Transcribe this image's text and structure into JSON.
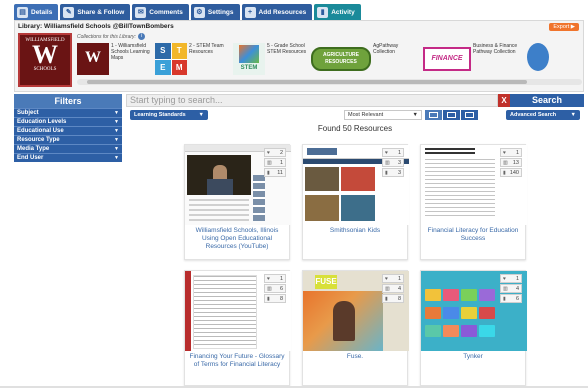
{
  "tabs": [
    {
      "label": "Details",
      "icon": "details-icon",
      "glyph": "▤"
    },
    {
      "label": "Share & Follow",
      "icon": "share-icon",
      "glyph": "✎"
    },
    {
      "label": "Comments",
      "icon": "comments-icon",
      "glyph": "✉"
    },
    {
      "label": "Settings",
      "icon": "gear-icon",
      "glyph": "⚙"
    },
    {
      "label": "Add Resources",
      "icon": "add-resources-icon",
      "glyph": "+"
    },
    {
      "label": "Activity",
      "icon": "activity-icon",
      "glyph": "▮"
    }
  ],
  "library": {
    "title": "Library: Williamsfield Schools @BillTownBombers",
    "export_label": "Export ▶",
    "logo_text_top": "WILLIAMSFIELD",
    "logo_letter": "W",
    "logo_text_bottom": "SCHOOLS",
    "collections_label": "Collections for this Library:",
    "info_glyph": "i",
    "collections": [
      {
        "label": "1 - Williamsfield Schools Learning Maps",
        "thumb_text": "W"
      },
      {
        "label": "2 - STEM Team Resources",
        "thumb_letters": [
          "S",
          "T",
          "E",
          "M"
        ]
      },
      {
        "label": "5 - Grade School STEM Resources",
        "thumb_text": "STEM"
      },
      {
        "label": "AgPathway Collection",
        "thumb_text": "AGRICULTURE RESOURCES"
      },
      {
        "label": "Business & Finance Pathway Collection",
        "thumb_text": "FINANCE"
      }
    ]
  },
  "filters": {
    "heading": "Filters",
    "items": [
      "Subject",
      "Education Levels",
      "Educational Use",
      "Resource Type",
      "Media Type",
      "End User"
    ],
    "arrow": "▼"
  },
  "search": {
    "placeholder": "Start typing to search...",
    "clear_label": "X",
    "button_label": "Search"
  },
  "toolbar": {
    "standards_label": "Learning Standards",
    "sort_value": "Most Relevant",
    "advanced_label": "Advanced Search",
    "dropdown_arrow": "▼"
  },
  "results": {
    "found_text": "Found 50 Resources",
    "cards": [
      {
        "title": "Williamsfield Schools, Illinois Using Open Educational Resources (YouTube)",
        "stats": [
          "2",
          "1",
          "11"
        ]
      },
      {
        "title": "Smithsonian Kids",
        "stats": [
          "1",
          "3",
          "3"
        ]
      },
      {
        "title": "Financial Literacy for Education Success",
        "stats": [
          "1",
          "13",
          "140"
        ]
      },
      {
        "title": "Financing Your Future - Glossary of Terms for Financial Literacy",
        "stats": [
          "1",
          "6",
          "8"
        ]
      },
      {
        "title": "Fuse.",
        "stats": [
          "1",
          "4",
          "8"
        ]
      },
      {
        "title": "Tynker",
        "stats": [
          "1",
          "4",
          "6"
        ]
      }
    ],
    "stat_icons": [
      "♥",
      "▥",
      "▮"
    ]
  },
  "shots": {
    "fuse_logo": "FUSE"
  },
  "colors": {
    "tab_blue": "#2f5d9e",
    "filter_blue": "#2d5fa5",
    "link_blue": "#3a6aa8",
    "export_orange": "#f0742c",
    "clear_red": "#c0312b",
    "logo_maroon": "#6a1414"
  }
}
